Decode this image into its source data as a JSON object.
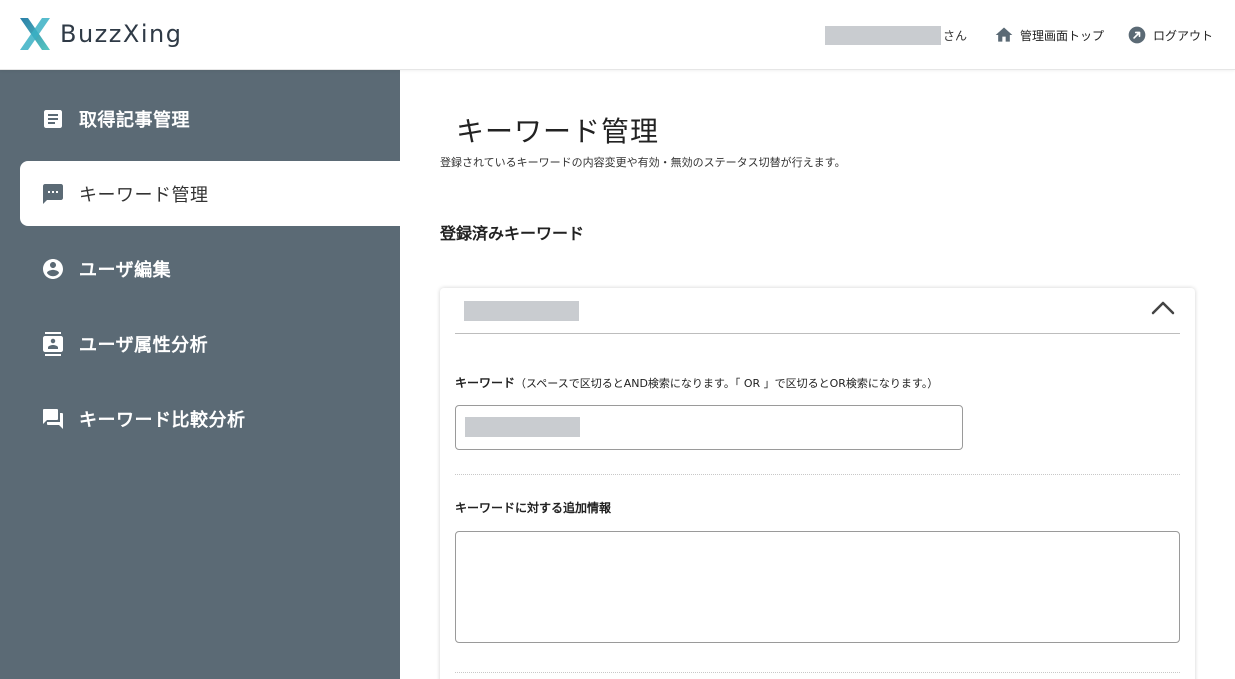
{
  "header": {
    "brand": "BuzzXing",
    "user_suffix": "さん",
    "admin_top_label": "管理画面トップ",
    "logout_label": "ログアウト"
  },
  "sidebar": {
    "items": [
      {
        "label": "取得記事管理",
        "icon": "article-icon",
        "active": false
      },
      {
        "label": "キーワード管理",
        "icon": "chat-bubble-icon",
        "active": true
      },
      {
        "label": "ユーザ編集",
        "icon": "account-circle-icon",
        "active": false
      },
      {
        "label": "ユーザ属性分析",
        "icon": "contact-card-icon",
        "active": false
      },
      {
        "label": "キーワード比較分析",
        "icon": "forum-icon",
        "active": false
      }
    ]
  },
  "main": {
    "title": "キーワード管理",
    "description": "登録されているキーワードの内容変更や有効・無効のステータス切替が行えます。",
    "section_title": "登録済みキーワード",
    "card": {
      "keyword_label": "キーワード",
      "keyword_note": "（スペースで区切るとAND検索になります。「 OR 」で区切るとOR検索になります。）",
      "extra_label": "キーワードに対する追加情報",
      "extra_value": ""
    }
  },
  "colors": {
    "sidebar_bg": "#5b6a75",
    "logo_accent": "#3ab0c4",
    "mask": "#c9ccd0"
  }
}
